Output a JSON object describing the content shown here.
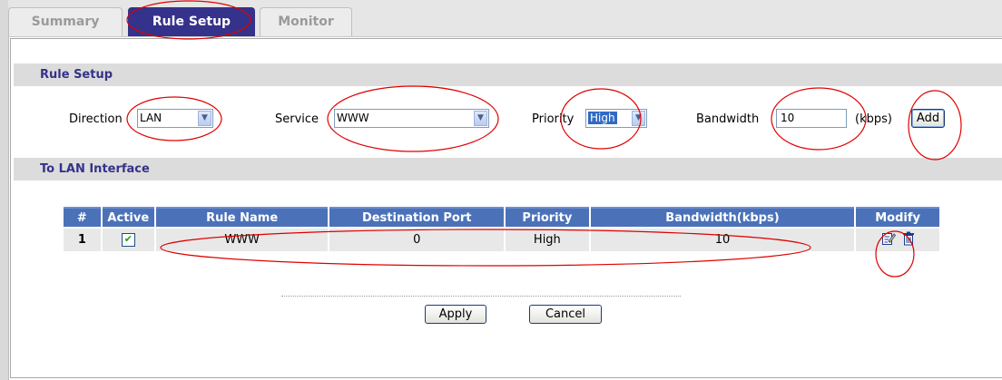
{
  "tabs": {
    "summary": "Summary",
    "rule_setup": "Rule Setup",
    "monitor": "Monitor"
  },
  "rule_setup": {
    "heading": "Rule Setup",
    "direction_label": "Direction",
    "direction_value": "LAN",
    "service_label": "Service",
    "service_value": "WWW",
    "priority_label": "Priority",
    "priority_value": "High",
    "bandwidth_label": "Bandwidth",
    "bandwidth_value": "10",
    "bandwidth_unit": "(kbps)",
    "add_label": "Add"
  },
  "interface": {
    "heading": "To LAN Interface",
    "columns": [
      "#",
      "Active",
      "Rule Name",
      "Destination Port",
      "Priority",
      "Bandwidth(kbps)",
      "Modify"
    ],
    "rows": [
      {
        "num": "1",
        "active": true,
        "rule_name": "WWW",
        "dest_port": "0",
        "priority": "High",
        "bandwidth": "10"
      }
    ]
  },
  "footer": {
    "apply_label": "Apply",
    "cancel_label": "Cancel"
  },
  "icons": {
    "dropdown": "chevron-down-icon",
    "edit": "edit-icon",
    "delete": "trash-icon",
    "check": "checkmark-icon"
  },
  "colors": {
    "accent": "#34328a",
    "table_header": "#4b72b8",
    "row_bg": "#e8e8e8",
    "annotation": "#e00000"
  }
}
